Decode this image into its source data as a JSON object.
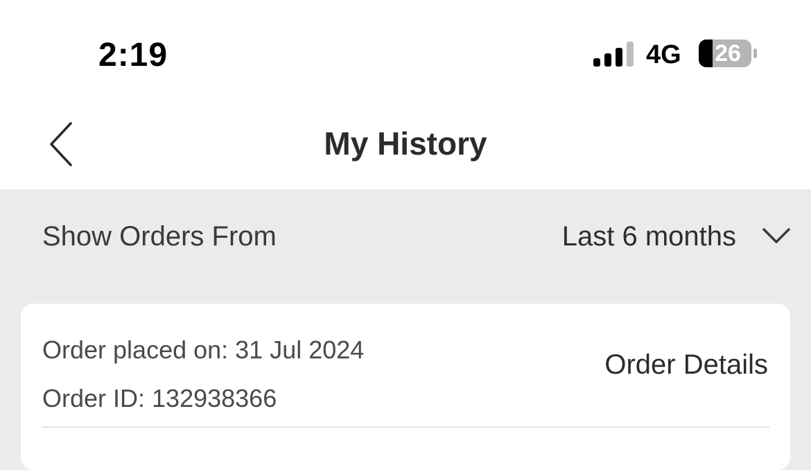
{
  "status_bar": {
    "time": "2:19",
    "network": "4G",
    "battery": "26"
  },
  "header": {
    "title": "My History",
    "back_icon": "chevron-left-icon"
  },
  "filter": {
    "label": "Show Orders From",
    "selected": "Last 6 months",
    "dropdown_icon": "chevron-down-icon"
  },
  "orders": [
    {
      "placed_on": "Order placed on: 31 Jul 2024",
      "order_id": "Order ID: 132938366",
      "details_label": "Order Details"
    }
  ]
}
